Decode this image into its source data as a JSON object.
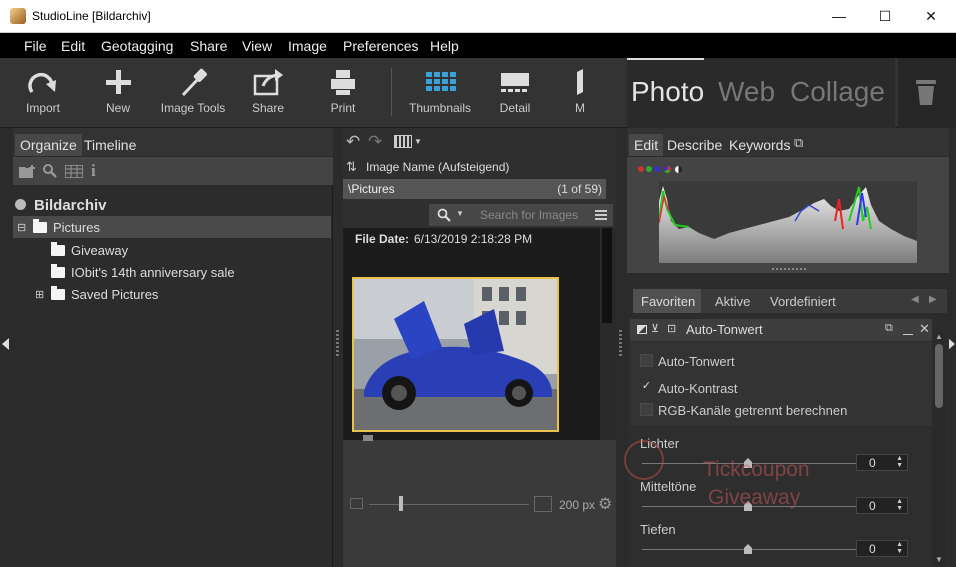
{
  "window": {
    "title": "StudioLine [Bildarchiv]",
    "minimize": "—",
    "maximize": "☐",
    "close": "✕"
  },
  "menu": [
    "File",
    "Edit",
    "Geotagging",
    "Share",
    "View",
    "Image",
    "Preferences",
    "Help"
  ],
  "toolbar": {
    "buttons": [
      {
        "label": "Import",
        "icon": "import-icon"
      },
      {
        "label": "New",
        "icon": "plus-icon"
      },
      {
        "label": "Image Tools",
        "icon": "eyedropper-icon"
      },
      {
        "label": "Share",
        "icon": "share-icon"
      },
      {
        "label": "Print",
        "icon": "printer-icon"
      },
      {
        "label": "Thumbnails",
        "icon": "thumbnails-icon"
      },
      {
        "label": "Detail",
        "icon": "detail-icon"
      },
      {
        "label": "M",
        "icon": "map-icon"
      }
    ],
    "modes": [
      "Photo",
      "Web",
      "Collage"
    ],
    "active_mode": "Photo"
  },
  "left": {
    "tabs": [
      "Organize",
      "Timeline"
    ],
    "archive": "Bildarchiv",
    "tree": [
      {
        "label": "Pictures",
        "expander": "⊟"
      },
      {
        "label": "Giveaway",
        "expander": ""
      },
      {
        "label": "IObit's 14th anniversary sale",
        "expander": ""
      },
      {
        "label": "Saved Pictures",
        "expander": "⊞"
      }
    ]
  },
  "middle": {
    "sort_label": "Image Name (Aufsteigend)",
    "path": "\\Pictures",
    "count": "(1 of 59)",
    "search_placeholder": "Search for Images",
    "file_date_label": "File Date:",
    "file_date_value": "6/13/2019 2:18:28 PM",
    "size_value": "200 px"
  },
  "right": {
    "tabs": [
      "Edit",
      "Describe",
      "Keywords"
    ],
    "filter_tabs": [
      "Favoriten",
      "Aktive",
      "Vordefiniert"
    ],
    "section_title": "Auto-Tonwert",
    "options": [
      {
        "label": "Auto-Tonwert",
        "checked": false,
        "mark": ""
      },
      {
        "label": "Auto-Kontrast",
        "checked": true,
        "mark": "✓"
      },
      {
        "label": "RGB-Kanäle getrennt berechnen",
        "checked": false,
        "mark": ""
      }
    ],
    "sliders": [
      {
        "label": "Lichter",
        "value": "0"
      },
      {
        "label": "Mitteltöne",
        "value": "0"
      },
      {
        "label": "Tiefen",
        "value": "0"
      }
    ]
  },
  "watermark": {
    "line1": "Tickcoupon",
    "line2": "Giveaway"
  }
}
